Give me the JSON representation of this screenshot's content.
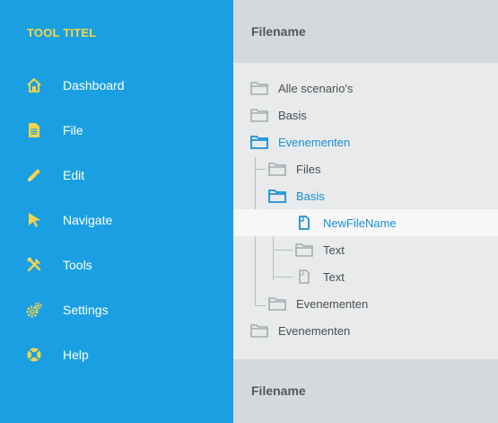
{
  "app": {
    "title": "TOOL TITEL"
  },
  "sidebar": {
    "items": [
      {
        "label": "Dashboard",
        "icon": "home-icon"
      },
      {
        "label": "File",
        "icon": "file-icon"
      },
      {
        "label": "Edit",
        "icon": "pencil-icon"
      },
      {
        "label": "Navigate",
        "icon": "cursor-icon"
      },
      {
        "label": "Tools",
        "icon": "tools-icon"
      },
      {
        "label": "Settings",
        "icon": "gears-icon"
      },
      {
        "label": "Help",
        "icon": "lifebuoy-icon"
      }
    ]
  },
  "panel": {
    "header_title": "Filename",
    "footer_title": "Filename",
    "tree": [
      {
        "label": "Alle scenario's",
        "type": "folder",
        "state": "normal"
      },
      {
        "label": "Basis",
        "type": "folder",
        "state": "normal"
      },
      {
        "label": "Evenementen",
        "type": "folder",
        "state": "open"
      },
      {
        "label": "Files",
        "type": "folder",
        "state": "normal"
      },
      {
        "label": "Basis",
        "type": "folder",
        "state": "open"
      },
      {
        "label": "NewFileName",
        "type": "file",
        "state": "selected"
      },
      {
        "label": "Text",
        "type": "folder",
        "state": "normal"
      },
      {
        "label": "Text",
        "type": "file",
        "state": "normal"
      },
      {
        "label": "Evenementen",
        "type": "folder",
        "state": "normal"
      },
      {
        "label": "Evenementen",
        "type": "folder",
        "state": "normal"
      }
    ]
  },
  "colors": {
    "sidebar_bg": "#1aa0e2",
    "accent_yellow": "#f5d44a",
    "active_blue": "#1a8fd6",
    "icon_grey": "#a6abae",
    "panel_bg": "#e8eaeb",
    "header_bg": "#d4d9dd"
  }
}
